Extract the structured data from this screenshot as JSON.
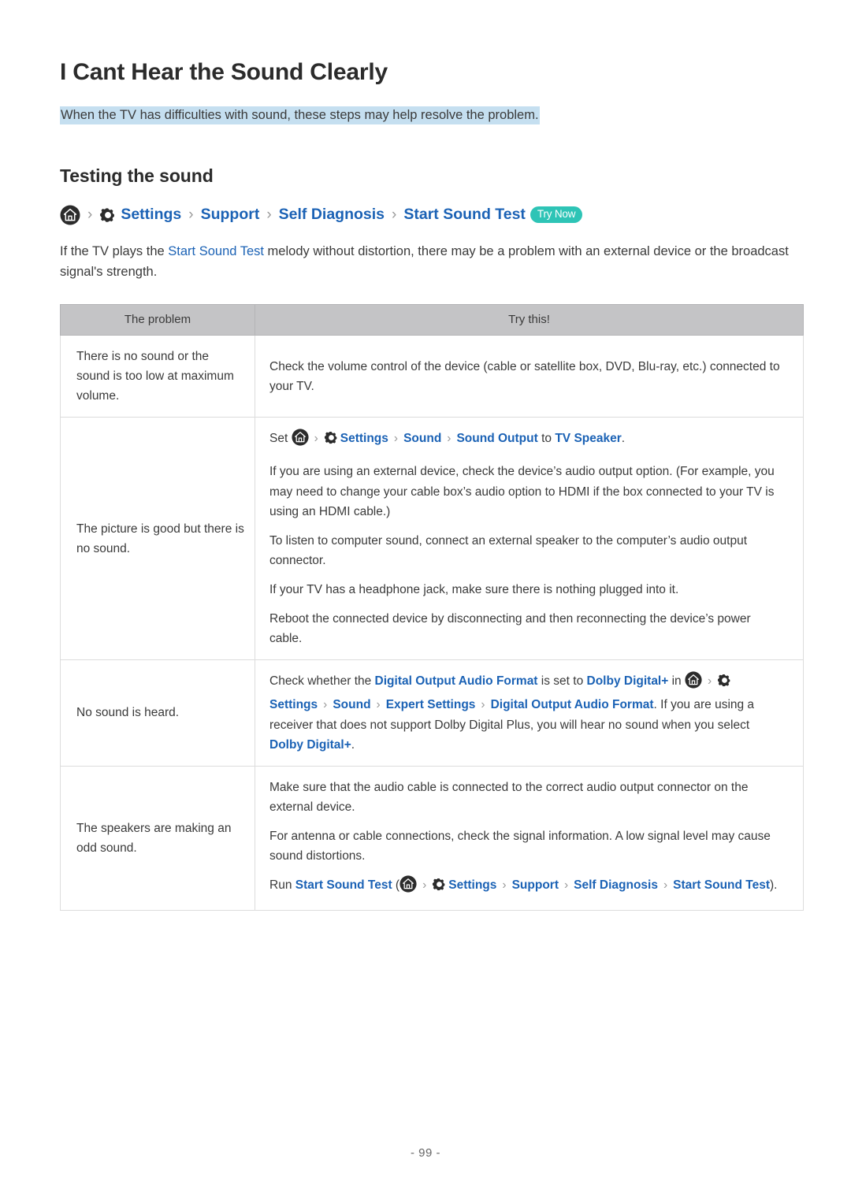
{
  "document": {
    "title": "I Cant Hear the Sound Clearly",
    "intro": "When the TV has difficulties with sound, these steps may help resolve the problem.",
    "section_title": "Testing the sound",
    "page_number": "- 99 -"
  },
  "breadcrumb_main": {
    "home_icon": "home-icon",
    "gear_icon": "gear-icon",
    "separator": "›",
    "items": [
      "Settings",
      "Support",
      "Self Diagnosis",
      "Start Sound Test"
    ],
    "badge": "Try Now"
  },
  "lead_paragraph": {
    "part1": "If the TV plays the ",
    "link": "Start Sound Test",
    "part2": " melody without distortion, there may be a problem with an external device or the broadcast signal's strength."
  },
  "table": {
    "headers": [
      "The problem",
      "Try this!"
    ],
    "rows": [
      {
        "problem": "There is no sound or the sound is too low at maximum volume.",
        "items": [
          {
            "type": "text",
            "text": "Check the volume control of the device (cable or satellite box, DVD, Blu-ray, etc.) connected to your TV."
          }
        ]
      },
      {
        "problem": "The picture is good but there is no sound.",
        "items": [
          {
            "type": "path",
            "prefix": "Set ",
            "crumbs": [
              "Settings",
              "Sound",
              "Sound Output"
            ],
            "middle": " to ",
            "target": "TV Speaker",
            "suffix": "."
          },
          {
            "type": "text",
            "text": "If you are using an external device, check the device’s audio output option. (For example, you may need to change your cable box’s audio option to HDMI if the box connected to your TV is using an HDMI cable.)"
          },
          {
            "type": "text",
            "text": "To listen to computer sound, connect an external speaker to the computer’s audio output connector."
          },
          {
            "type": "text",
            "text": "If your TV has a headphone jack, make sure there is nothing plugged into it."
          },
          {
            "type": "text",
            "text": "Reboot the connected device by disconnecting and then reconnecting the device’s power cable."
          }
        ]
      },
      {
        "problem": "No sound is heard.",
        "items": [
          {
            "type": "dolby",
            "lead": "Check whether the ",
            "format_link": "Digital Output Audio Format",
            "mid1": " is set to ",
            "dolby_link": "Dolby Digital+",
            "mid2": " in ",
            "crumbs": [
              "Settings",
              "Sound",
              "Expert Settings",
              "Digital Output Audio Format"
            ],
            "tail": ". If you are using a receiver that does not support Dolby Digital Plus, you will hear no sound when you select ",
            "dolby_link2": "Dolby Digital+",
            "end": "."
          }
        ]
      },
      {
        "problem": "The speakers are making an odd sound.",
        "items": [
          {
            "type": "text",
            "text": "Make sure that the audio cable is connected to the correct audio output connector on the external device."
          },
          {
            "type": "text",
            "text": "For antenna or cable connections, check the signal information. A low signal level may cause sound distortions."
          },
          {
            "type": "run",
            "prefix": "Run ",
            "run_link": "Start Sound Test",
            "open_paren": " (",
            "crumbs": [
              "Settings",
              "Support",
              "Self Diagnosis",
              "Start Sound Test"
            ],
            "close_paren": ")."
          }
        ]
      }
    ]
  },
  "colors": {
    "link_blue": "#1b62b5",
    "badge_teal": "#2ec4b6",
    "highlight_blue": "#c5dff0",
    "table_header_gray": "#c4c4c6"
  }
}
